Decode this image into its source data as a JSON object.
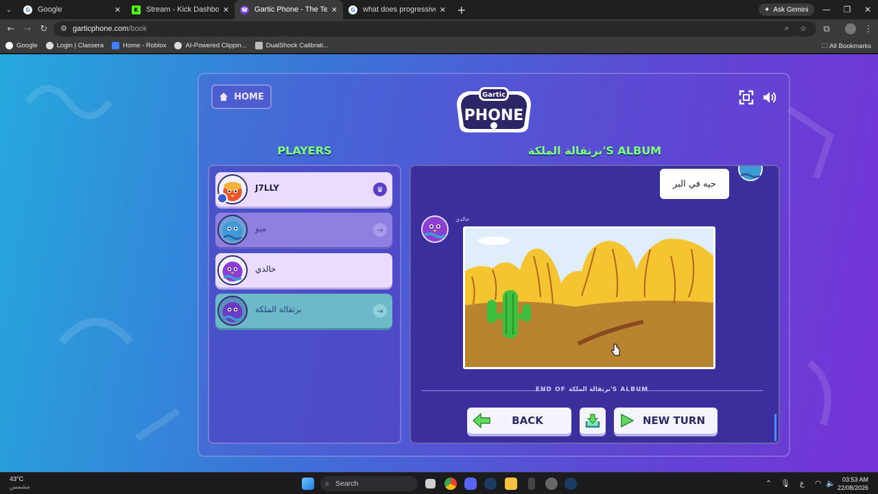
{
  "browser": {
    "tabs": [
      {
        "title": "Google",
        "fav_color": "#ffffff",
        "fav_letter": "G",
        "active": false
      },
      {
        "title": "Stream - Kick Dashboard",
        "fav_color": "#53fc18",
        "fav_letter": "K",
        "active": false
      },
      {
        "title": "Gartic Phone - The Telephone G",
        "fav_color": "#7a3fd6",
        "fav_letter": "G",
        "active": true
      },
      {
        "title": "what does progressive mean - G",
        "fav_color": "#ffffff",
        "fav_letter": "G",
        "active": false
      }
    ],
    "ask_gemini": "Ask Gemini",
    "url_host": "garticphone.com",
    "url_path": "/book",
    "bookmarks": [
      "Google",
      "Login | Classera",
      "Home - Roblox",
      "AI-Powered Clippin...",
      "DualShock Calibrati..."
    ],
    "all_bookmarks": "All Bookmarks"
  },
  "game": {
    "home_label": "HOME",
    "logo_line1": "Gartic",
    "logo_line2": "PHONE",
    "players_title": "PLAYERS",
    "album_title": "برتقالة الملكة'S ALBUM",
    "players": [
      {
        "name": "J7LLY",
        "badge": "crown",
        "bg": "#e9dcff",
        "text_color": "#1e1e4a"
      },
      {
        "name": "ميو",
        "badge": "exit",
        "bg": "#8f7fe0",
        "text_color": "#3a3a8a"
      },
      {
        "name": "خالدي",
        "badge": "none",
        "bg": "#e9dcff",
        "text_color": "#1e1e4a"
      },
      {
        "name": "برتقالة الملكة",
        "badge": "exit",
        "bg": "#6bb9c9",
        "text_color": "#2c3f7a"
      }
    ],
    "previous_guess": "حيه في البر",
    "drawing_author": "خالدي",
    "end_label": "END OF برتقالة الملكة'S ALBUM",
    "back_label": "BACK",
    "new_turn_label": "NEW TURN"
  },
  "taskbar": {
    "temperature": "43°C",
    "weather_desc": "مشمس",
    "search_label": "Search",
    "language": "ع",
    "time": "03:53 AM",
    "date": "22/08/2026"
  }
}
